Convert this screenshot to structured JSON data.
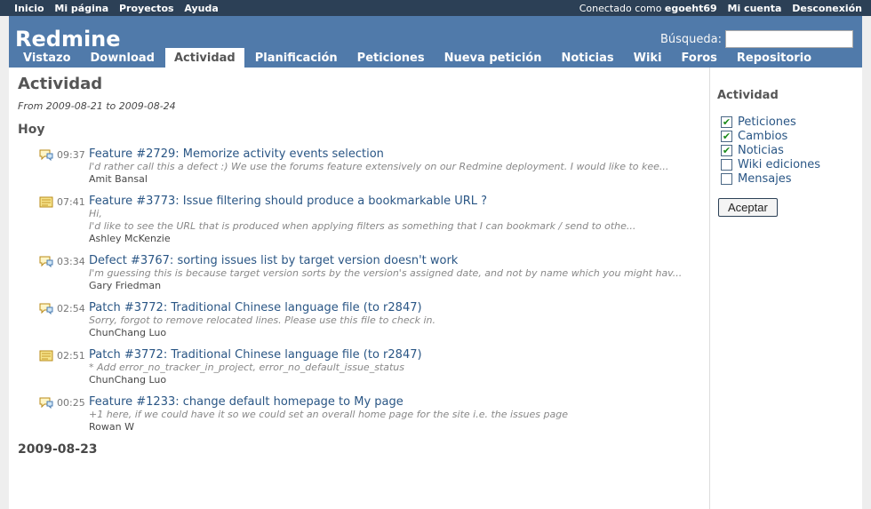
{
  "top_menu": {
    "items": [
      "Inicio",
      "Mi página",
      "Proyectos",
      "Ayuda"
    ],
    "logged_prefix": "Conectado como",
    "username": "egoeht69",
    "account": "Mi cuenta",
    "logout": "Desconexión"
  },
  "header": {
    "title": "Redmine",
    "search_label": "Búsqueda:"
  },
  "main_menu": {
    "items": [
      "Vistazo",
      "Download",
      "Actividad",
      "Planificación",
      "Peticiones",
      "Nueva petición",
      "Noticias",
      "Wiki",
      "Foros",
      "Repositorio"
    ],
    "selected": "Actividad"
  },
  "content": {
    "title": "Actividad",
    "subtitle": "From 2009-08-21 to 2009-08-24",
    "day": "Hoy",
    "events": [
      {
        "icon": "reply-comment-icon",
        "time": "09:37",
        "title": "Feature #2729: Memorize activity events selection",
        "desc": "I'd rather call this a defect :) We use the forums feature extensively on our Redmine deployment. I would like to kee...",
        "author": "Amit Bansal"
      },
      {
        "icon": "note-icon",
        "time": "07:41",
        "title": "Feature #3773: Issue filtering should produce a bookmarkable URL ?",
        "desc": "Hi,\nI'd like to see the URL that is produced when applying filters as something that I can bookmark / send to othe...",
        "author": "Ashley McKenzie"
      },
      {
        "icon": "reply-comment-icon",
        "time": "03:34",
        "title": "Defect #3767: sorting issues list by target version doesn't work",
        "desc": "I'm guessing this is because target version sorts by the version's assigned date, and not by name which you might hav...",
        "author": "Gary Friedman"
      },
      {
        "icon": "reply-comment-icon",
        "time": "02:54",
        "title": "Patch #3772: Traditional Chinese language file (to r2847)",
        "desc": "Sorry, forgot to remove relocated lines. Please use this file to check in.",
        "author": "ChunChang Luo"
      },
      {
        "icon": "note-icon",
        "time": "02:51",
        "title": "Patch #3772: Traditional Chinese language file (to r2847)",
        "desc": "* Add error_no_tracker_in_project, error_no_default_issue_status",
        "author": "ChunChang Luo"
      },
      {
        "icon": "reply-comment-icon",
        "time": "00:25",
        "title": "Feature #1233: change default homepage to My page",
        "desc": "+1 here, if we could have it so we could set an overall home page for the site i.e. the issues page",
        "author": "Rowan W"
      }
    ],
    "older_date": "2009-08-23"
  },
  "sidebar": {
    "title": "Actividad",
    "filters": [
      {
        "label": "Peticiones",
        "checked": true
      },
      {
        "label": "Cambios",
        "checked": true
      },
      {
        "label": "Noticias",
        "checked": true
      },
      {
        "label": "Wiki ediciones",
        "checked": false
      },
      {
        "label": "Mensajes",
        "checked": false
      }
    ],
    "submit": "Aceptar"
  }
}
